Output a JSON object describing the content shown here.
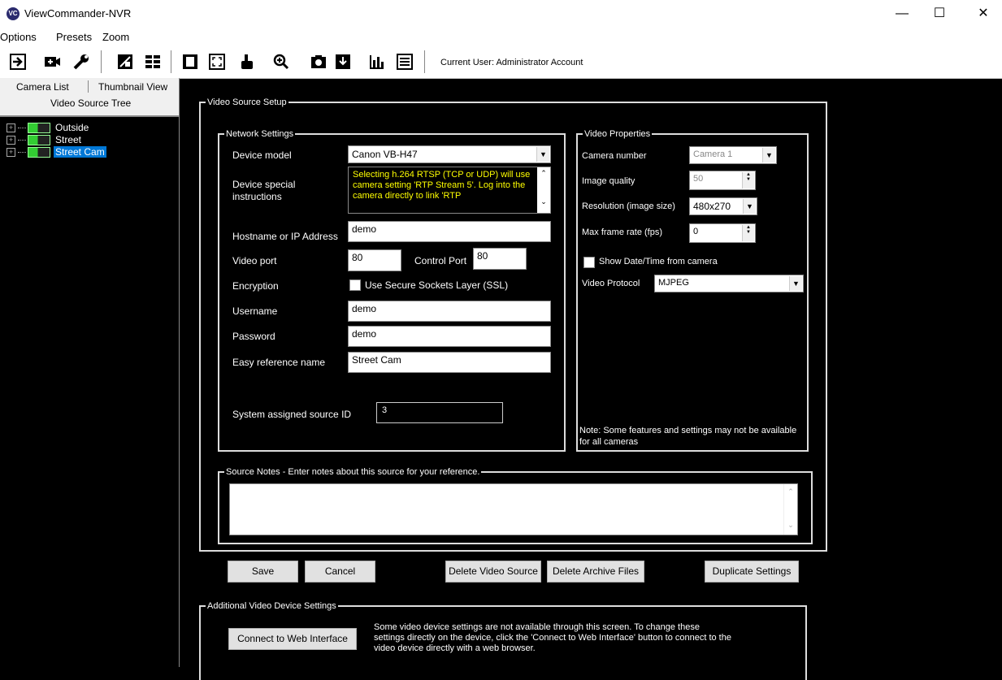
{
  "window": {
    "title": "ViewCommander-NVR",
    "icon_text": "VC",
    "minimize": "—",
    "maximize": "☐",
    "close": "✕"
  },
  "menu": [
    "Options",
    "Presets",
    "Zoom"
  ],
  "toolbar": {
    "current_user": "Current User: Administrator Account"
  },
  "left_panel": {
    "tabs": {
      "camera_list": "Camera List",
      "thumbnail_view": "Thumbnail View",
      "video_source_tree": "Video Source Tree"
    },
    "tree": [
      {
        "label": "Outside",
        "selected": false
      },
      {
        "label": "Street",
        "selected": false
      },
      {
        "label": "Street Cam",
        "selected": true
      }
    ]
  },
  "video_source_setup": {
    "title": "Video Source Setup",
    "network": {
      "title": "Network Settings",
      "device_model_label": "Device model",
      "device_model_value": "Canon VB-H47",
      "special_label": "Device special instructions",
      "special_text": "Selecting h.264 RTSP (TCP or UDP) will use camera setting 'RTP Stream 5'. Log into the camera directly to link 'RTP",
      "hostname_label": "Hostname or IP Address",
      "hostname_value": "demo",
      "video_port_label": "Video port",
      "video_port_value": "80",
      "control_port_label": "Control Port",
      "control_port_value": "80",
      "encryption_label": "Encryption",
      "ssl_label": "Use Secure Sockets Layer (SSL)",
      "username_label": "Username",
      "username_value": "demo",
      "password_label": "Password",
      "password_value": "demo",
      "reference_label": "Easy reference name",
      "reference_value": "Street Cam",
      "source_id_label": "System assigned source ID",
      "source_id_value": "3"
    },
    "video": {
      "title": "Video Properties",
      "camera_number_label": "Camera number",
      "camera_number_value": "Camera 1",
      "image_quality_label": "Image quality",
      "image_quality_value": "50",
      "resolution_label": "Resolution (image size)",
      "resolution_value": "480x270",
      "max_fps_label": "Max frame rate (fps)",
      "max_fps_value": "0",
      "show_datetime_label": "Show Date/Time from camera",
      "protocol_label": "Video Protocol",
      "protocol_value": "MJPEG",
      "note": "Note: Some features and settings may not be available for all cameras"
    },
    "notes": {
      "title": "Source Notes - Enter notes about this source for your reference.",
      "value": ""
    }
  },
  "buttons": {
    "save": "Save",
    "cancel": "Cancel",
    "delete_source": "Delete Video Source",
    "delete_archive": "Delete Archive Files",
    "duplicate": "Duplicate Settings"
  },
  "additional": {
    "title": "Additional Video Device Settings",
    "connect_button": "Connect to Web Interface",
    "description": "Some video device settings are not available through this screen. To change these settings directly on the device, click the 'Connect to Web Interface' button to connect to the video device directly with a web browser."
  },
  "colors": {
    "background": "#000000",
    "instruction_text": "#ffff00",
    "selection": "#0078d7",
    "camera_icon": "#33cc33"
  }
}
